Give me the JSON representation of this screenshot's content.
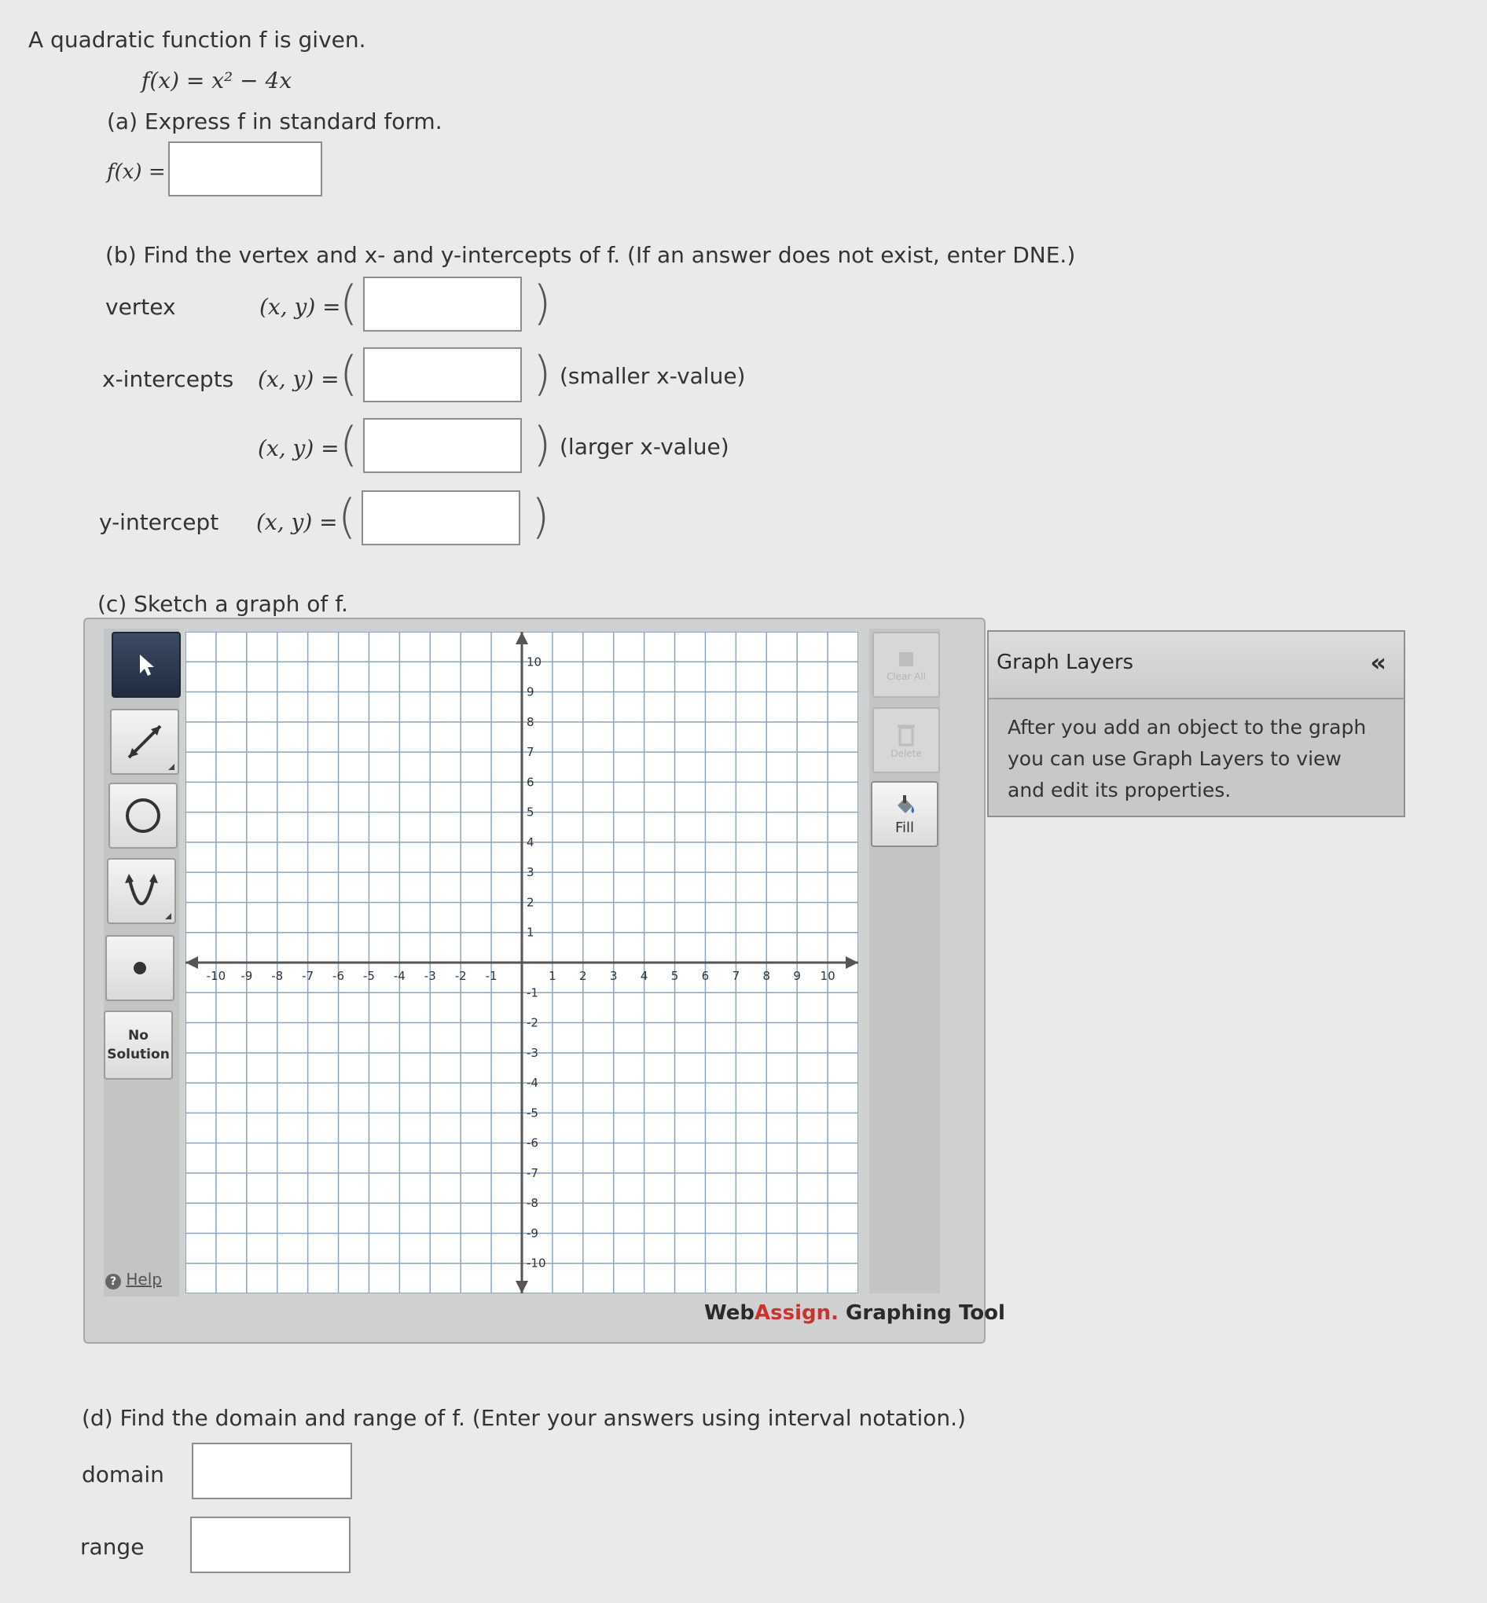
{
  "problem": {
    "intro": "A quadratic function f is given.",
    "function_def": "f(x) = x² − 4x"
  },
  "part_a": {
    "prompt": "(a) Express f in standard form.",
    "label": "f(x) =",
    "value": ""
  },
  "part_b": {
    "prompt": "(b) Find the vertex and x- and y-intercepts of f. (If an answer does not exist, enter DNE.)",
    "rows": [
      {
        "label": "vertex",
        "xy": "(x, y) =",
        "value": "",
        "note": ""
      },
      {
        "label": "x-intercepts",
        "xy": "(x, y) =",
        "value": "",
        "note": "(smaller x-value)"
      },
      {
        "label": "",
        "xy": "(x, y) =",
        "value": "",
        "note": "(larger x-value)"
      },
      {
        "label": "y-intercept",
        "xy": "(x, y) =",
        "value": "",
        "note": ""
      }
    ]
  },
  "part_c": {
    "prompt": "(c) Sketch a graph of f.",
    "tools": {
      "no_solution": "No\nSolution",
      "help": "Help",
      "clear_all": "Clear All",
      "delete": "Delete",
      "fill": "Fill"
    },
    "brand_main": "Web",
    "brand_accent": "Assign.",
    "brand_tail": " Graphing Tool",
    "layers_title": "Graph Layers",
    "layers_collapse": "«",
    "layers_body": "After you add an object to the graph you can use Graph Layers to view and edit its properties.",
    "chart_data": {
      "type": "scatter",
      "x_ticks": [
        -10,
        -9,
        -8,
        -7,
        -6,
        -5,
        -4,
        -3,
        -2,
        -1,
        1,
        2,
        3,
        4,
        5,
        6,
        7,
        8,
        9,
        10
      ],
      "y_ticks": [
        10,
        9,
        8,
        7,
        6,
        5,
        4,
        3,
        2,
        1,
        -1,
        -2,
        -3,
        -4,
        -5,
        -6,
        -7,
        -8,
        -9,
        -10
      ],
      "xlim": [
        -11,
        11
      ],
      "ylim": [
        -11,
        11
      ],
      "grid": true,
      "series": []
    }
  },
  "part_d": {
    "prompt": "(d) Find the domain and range of f. (Enter your answers using interval notation.)",
    "domain_label": "domain",
    "domain_value": "",
    "range_label": "range",
    "range_value": ""
  },
  "colors": {
    "background": "#e9eaea",
    "grid_line": "#8aa6bf",
    "axis": "#555555",
    "active_tool": "#2a3750",
    "brand_accent": "#c8352f"
  }
}
